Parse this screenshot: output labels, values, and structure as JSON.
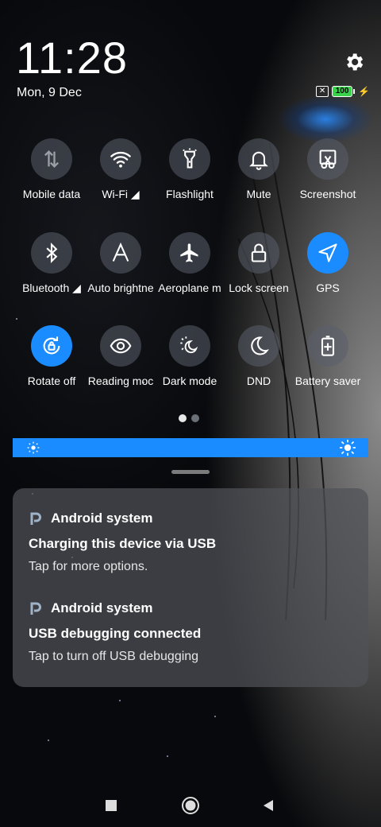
{
  "status": {
    "time": "11:28",
    "date": "Mon, 9 Dec",
    "battery_level": "100",
    "icons": [
      "settings-icon",
      "no-sim-icon",
      "battery-icon",
      "charging-icon"
    ]
  },
  "quick_settings": {
    "rows": [
      [
        {
          "label": "Mobile data",
          "icon": "mobile-data-icon",
          "active": false
        },
        {
          "label": "Wi-Fi ◢",
          "icon": "wifi-icon",
          "active": false
        },
        {
          "label": "Flashlight",
          "icon": "flashlight-icon",
          "active": false
        },
        {
          "label": "Mute",
          "icon": "bell-icon",
          "active": false
        },
        {
          "label": "Screenshot",
          "icon": "screenshot-icon",
          "active": false
        }
      ],
      [
        {
          "label": "Bluetooth ◢",
          "icon": "bluetooth-icon",
          "active": false
        },
        {
          "label": "Auto brightne",
          "icon": "auto-brightness-icon",
          "active": false
        },
        {
          "label": "Aeroplane m",
          "icon": "airplane-icon",
          "active": false
        },
        {
          "label": "Lock screen",
          "icon": "lock-icon",
          "active": false
        },
        {
          "label": "GPS",
          "icon": "location-icon",
          "active": true
        }
      ],
      [
        {
          "label": "Rotate off",
          "icon": "rotate-lock-icon",
          "active": true
        },
        {
          "label": "Reading moc",
          "icon": "eye-icon",
          "active": false
        },
        {
          "label": "Dark mode",
          "icon": "dark-mode-icon",
          "active": false
        },
        {
          "label": "DND",
          "icon": "moon-icon",
          "active": false
        },
        {
          "label": "Battery saver",
          "icon": "battery-saver-icon",
          "active": false
        }
      ]
    ],
    "page_count": 2,
    "current_page": 1,
    "accent_color": "#1a8cff"
  },
  "brightness": {
    "level": 1.0,
    "color": "#1a8cff"
  },
  "notifications": [
    {
      "app": "Android system",
      "title": "Charging this device via USB",
      "body": "Tap for more options."
    },
    {
      "app": "Android system",
      "title": "USB debugging connected",
      "body": "Tap to turn off USB debugging"
    }
  ],
  "navbar": {
    "buttons": [
      "recents-button",
      "home-button",
      "back-button"
    ]
  }
}
